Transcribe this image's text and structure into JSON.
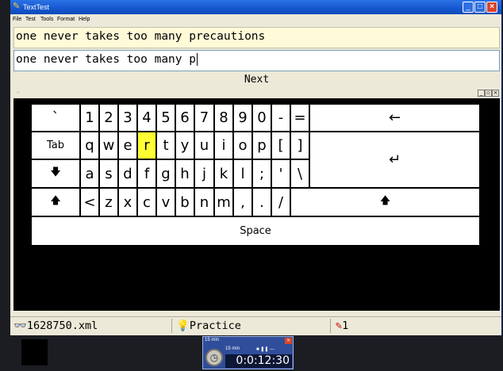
{
  "window": {
    "title": "TextTest",
    "menu": [
      "File",
      "Test",
      "Tools",
      "Format",
      "Help"
    ]
  },
  "prompt": {
    "text": "one never takes too many precautions"
  },
  "input": {
    "value": "one never takes too many p"
  },
  "next_label": "Next",
  "keyboard": {
    "highlighted_key": "r",
    "rows": [
      [
        "`",
        "1",
        "2",
        "3",
        "4",
        "5",
        "6",
        "7",
        "8",
        "9",
        "0",
        "-",
        "=",
        "←"
      ],
      [
        "Tab",
        "q",
        "w",
        "e",
        "r",
        "t",
        "y",
        "u",
        "i",
        "o",
        "p",
        "[",
        "]",
        "↵"
      ],
      [
        "🡇",
        "a",
        "s",
        "d",
        "f",
        "g",
        "h",
        "j",
        "k",
        "l",
        ";",
        "'",
        "\\"
      ],
      [
        "🡅",
        "<",
        "z",
        "x",
        "c",
        "v",
        "b",
        "n",
        "m",
        ",",
        ".",
        "/",
        "🡅"
      ],
      [
        "Space"
      ]
    ]
  },
  "statusbar": {
    "file": "1628750.xml",
    "mode": "Practice",
    "count": "1"
  },
  "timer": {
    "title": "15 min",
    "preset": "15 min",
    "display": "0:0:12:30"
  },
  "colors": {
    "titlebar": "#1556cf",
    "highlight_key": "#ffff33",
    "prompt_background": "#fffbd8"
  }
}
